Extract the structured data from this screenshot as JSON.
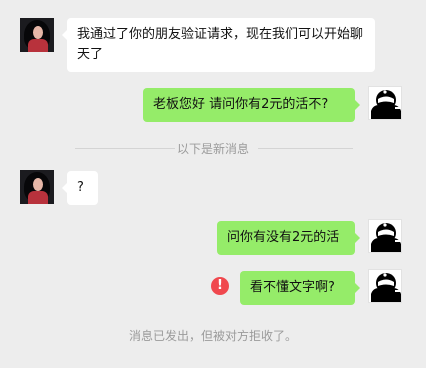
{
  "divider": {
    "text": "以下是新消息"
  },
  "messages": [
    {
      "side": "left",
      "text": "我通过了你的朋友验证请求，现在我们可以开始聊天了"
    },
    {
      "side": "right",
      "text": "老板您好 请问你有2元的活不?"
    },
    {
      "side": "left",
      "text": "?"
    },
    {
      "side": "right",
      "text": "问你有没有2元的活"
    },
    {
      "side": "right",
      "text": "看不懂文字啊?",
      "status": "failed"
    }
  ],
  "system_note": {
    "text": "消息已发出，但被对方拒收了。"
  },
  "icons": {
    "error": "exclamation-circle-icon",
    "error_glyph": "!"
  },
  "colors": {
    "background": "#ededed",
    "bubble_sent": "#95ec69",
    "bubble_received": "#ffffff",
    "error": "#f0484e"
  }
}
